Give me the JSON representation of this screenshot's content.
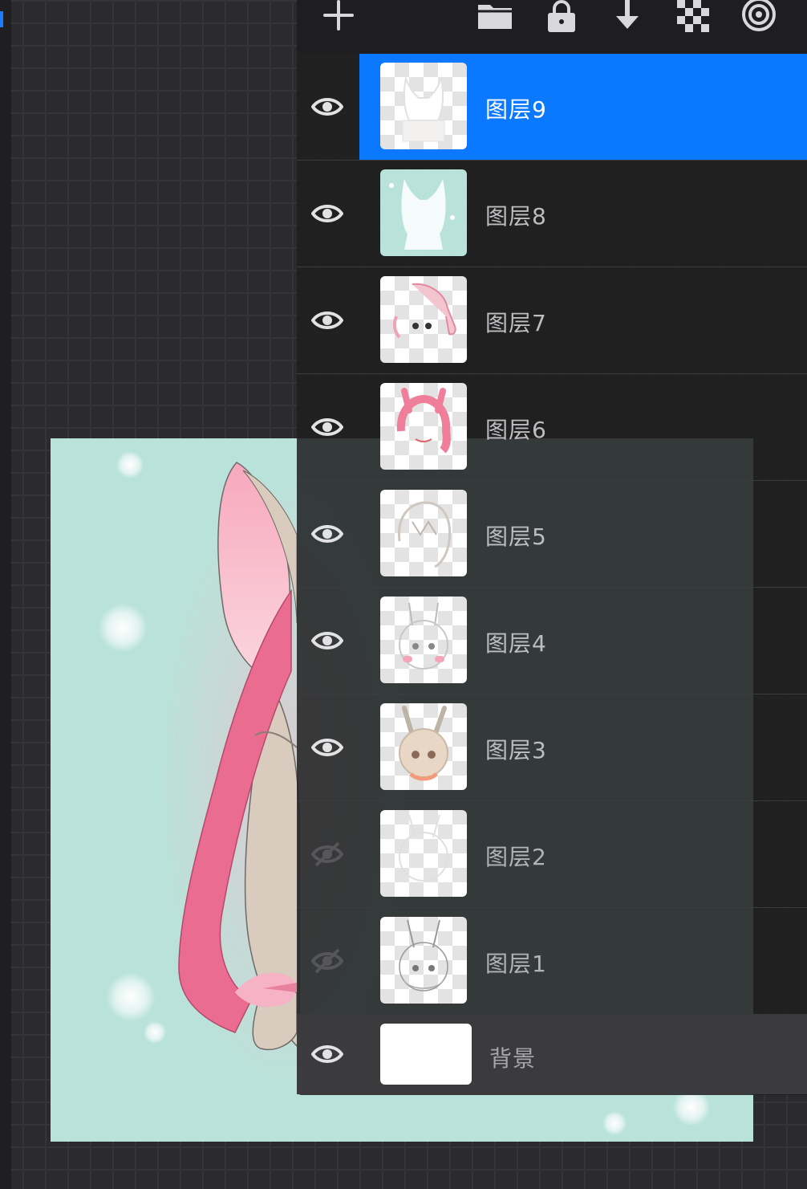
{
  "toolbar": {
    "tools": [
      {
        "name": "add-layer",
        "icon": "plus-icon"
      },
      {
        "name": "group",
        "icon": "folder-icon"
      },
      {
        "name": "lock",
        "icon": "lock-icon"
      },
      {
        "name": "merge-down",
        "icon": "arrow-down-icon"
      },
      {
        "name": "checker",
        "icon": "checkerboard-icon"
      },
      {
        "name": "reference",
        "icon": "spiral-icon"
      }
    ]
  },
  "layers": [
    {
      "label": "图层9",
      "visible": true,
      "selected": true
    },
    {
      "label": "图层8",
      "visible": true,
      "selected": false
    },
    {
      "label": "图层7",
      "visible": true,
      "selected": false
    },
    {
      "label": "图层6",
      "visible": true,
      "selected": false
    },
    {
      "label": "图层5",
      "visible": true,
      "selected": false
    },
    {
      "label": "图层4",
      "visible": true,
      "selected": false
    },
    {
      "label": "图层3",
      "visible": true,
      "selected": false
    },
    {
      "label": "图层2",
      "visible": false,
      "selected": false
    },
    {
      "label": "图层1",
      "visible": false,
      "selected": false
    }
  ],
  "background_layer": {
    "label": "背景",
    "visible": true
  },
  "colors": {
    "accent": "#0a78ff",
    "canvas": "#b9e3da",
    "panel": "#1e1e20"
  }
}
